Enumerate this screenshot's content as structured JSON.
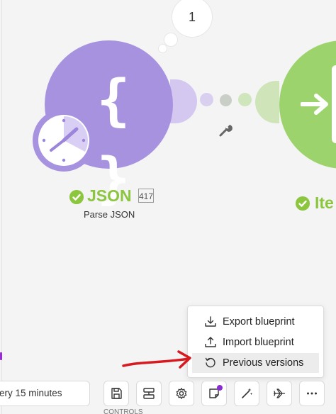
{
  "bubble": {
    "count": "1"
  },
  "json_module": {
    "title": "JSON",
    "badge": "417",
    "subtitle": "Parse JSON",
    "icon": "curly-braces-icon",
    "color": "#a792e0"
  },
  "iterator_module": {
    "title": "Ite",
    "icon": "iterator-arrows-icon",
    "color": "#9cd36d"
  },
  "menu": {
    "items": [
      {
        "label": "Export blueprint",
        "icon": "export-icon"
      },
      {
        "label": "Import blueprint",
        "icon": "import-icon"
      },
      {
        "label": "Previous versions",
        "icon": "history-icon"
      }
    ]
  },
  "toolbar": {
    "schedule_label": "ery 15 minutes",
    "buttons": [
      {
        "icon": "save-icon"
      },
      {
        "icon": "flow-control-icon"
      },
      {
        "icon": "gear-icon"
      },
      {
        "icon": "notes-icon"
      },
      {
        "icon": "magic-wand-icon"
      },
      {
        "icon": "airplane-icon"
      },
      {
        "icon": "more-icon"
      }
    ],
    "cut_label": "CONTROLS"
  },
  "colors": {
    "success": "#8cc63f",
    "annotation_arrow": "#d71920",
    "accent": "#8b2bd6"
  }
}
